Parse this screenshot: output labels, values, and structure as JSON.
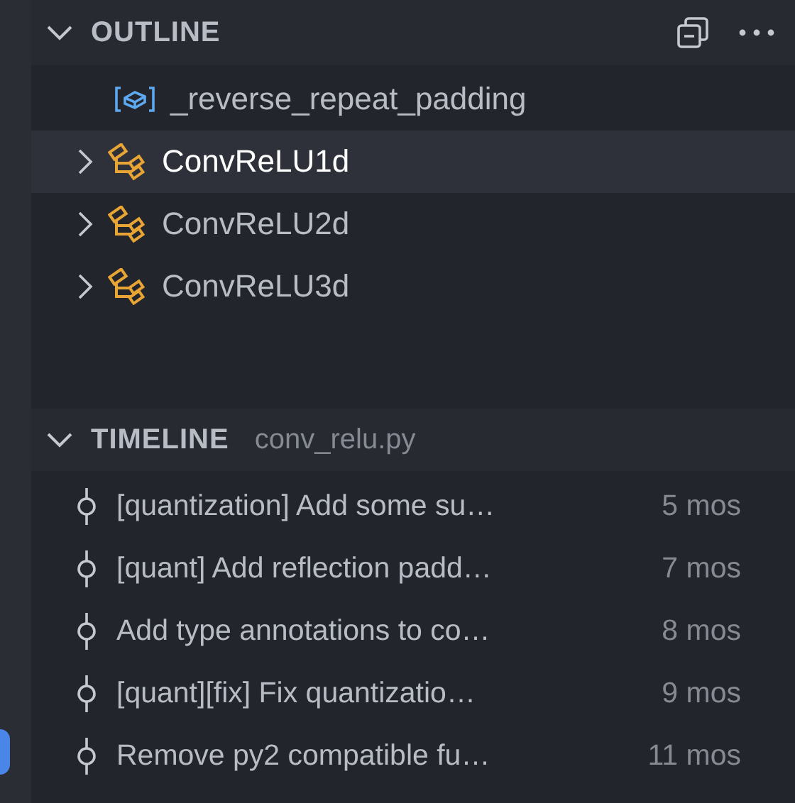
{
  "outline": {
    "title": "OUTLINE",
    "items": [
      {
        "kind": "variable",
        "label": "_reverse_repeat_padding",
        "selected": false
      },
      {
        "kind": "class",
        "label": "ConvReLU1d",
        "selected": true,
        "expanded": false
      },
      {
        "kind": "class",
        "label": "ConvReLU2d",
        "selected": false,
        "expanded": false
      },
      {
        "kind": "class",
        "label": "ConvReLU3d",
        "selected": false,
        "expanded": false
      }
    ]
  },
  "timeline": {
    "title": "TIMELINE",
    "file": "conv_relu.py",
    "entries": [
      {
        "message": "[quantization] Add some su…",
        "time": "5 mos"
      },
      {
        "message": "[quant] Add reflection padd…",
        "time": "7 mos"
      },
      {
        "message": "Add type annotations to co…",
        "time": "8 mos"
      },
      {
        "message": "[quant][fix] Fix quantizatio…",
        "time": "9 mos"
      },
      {
        "message": "Remove py2 compatible fu…",
        "time": "11 mos"
      }
    ]
  }
}
